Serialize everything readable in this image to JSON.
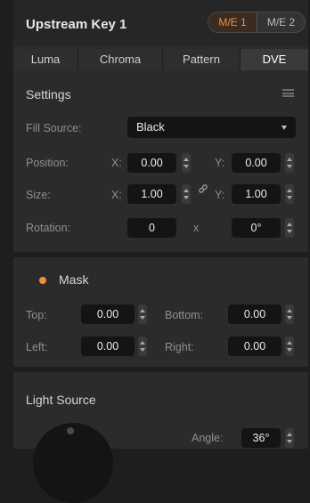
{
  "header": {
    "title": "Upstream Key 1",
    "me_buttons": [
      "M/E 1",
      "M/E 2"
    ]
  },
  "tabs": [
    "Luma",
    "Chroma",
    "Pattern",
    "DVE"
  ],
  "settings": {
    "title": "Settings",
    "fill_source_label": "Fill Source:",
    "fill_source_value": "Black",
    "position_label": "Position:",
    "size_label": "Size:",
    "rotation_label": "Rotation:",
    "x_label": "X:",
    "y_label": "Y:",
    "position_x": "0.00",
    "position_y": "0.00",
    "size_x": "1.00",
    "size_y": "1.00",
    "rotation_value": "0",
    "rotation_x": "x",
    "rotation_degrees": "0°"
  },
  "mask": {
    "title": "Mask",
    "top_label": "Top:",
    "bottom_label": "Bottom:",
    "left_label": "Left:",
    "right_label": "Right:",
    "top": "0.00",
    "bottom": "0.00",
    "left": "0.00",
    "right": "0.00"
  },
  "light_source": {
    "title": "Light Source",
    "angle_label": "Angle:",
    "angle": "36°"
  },
  "colors": {
    "accent": "#f0923a",
    "panel": "#2b2b2b",
    "field": "#141414"
  }
}
